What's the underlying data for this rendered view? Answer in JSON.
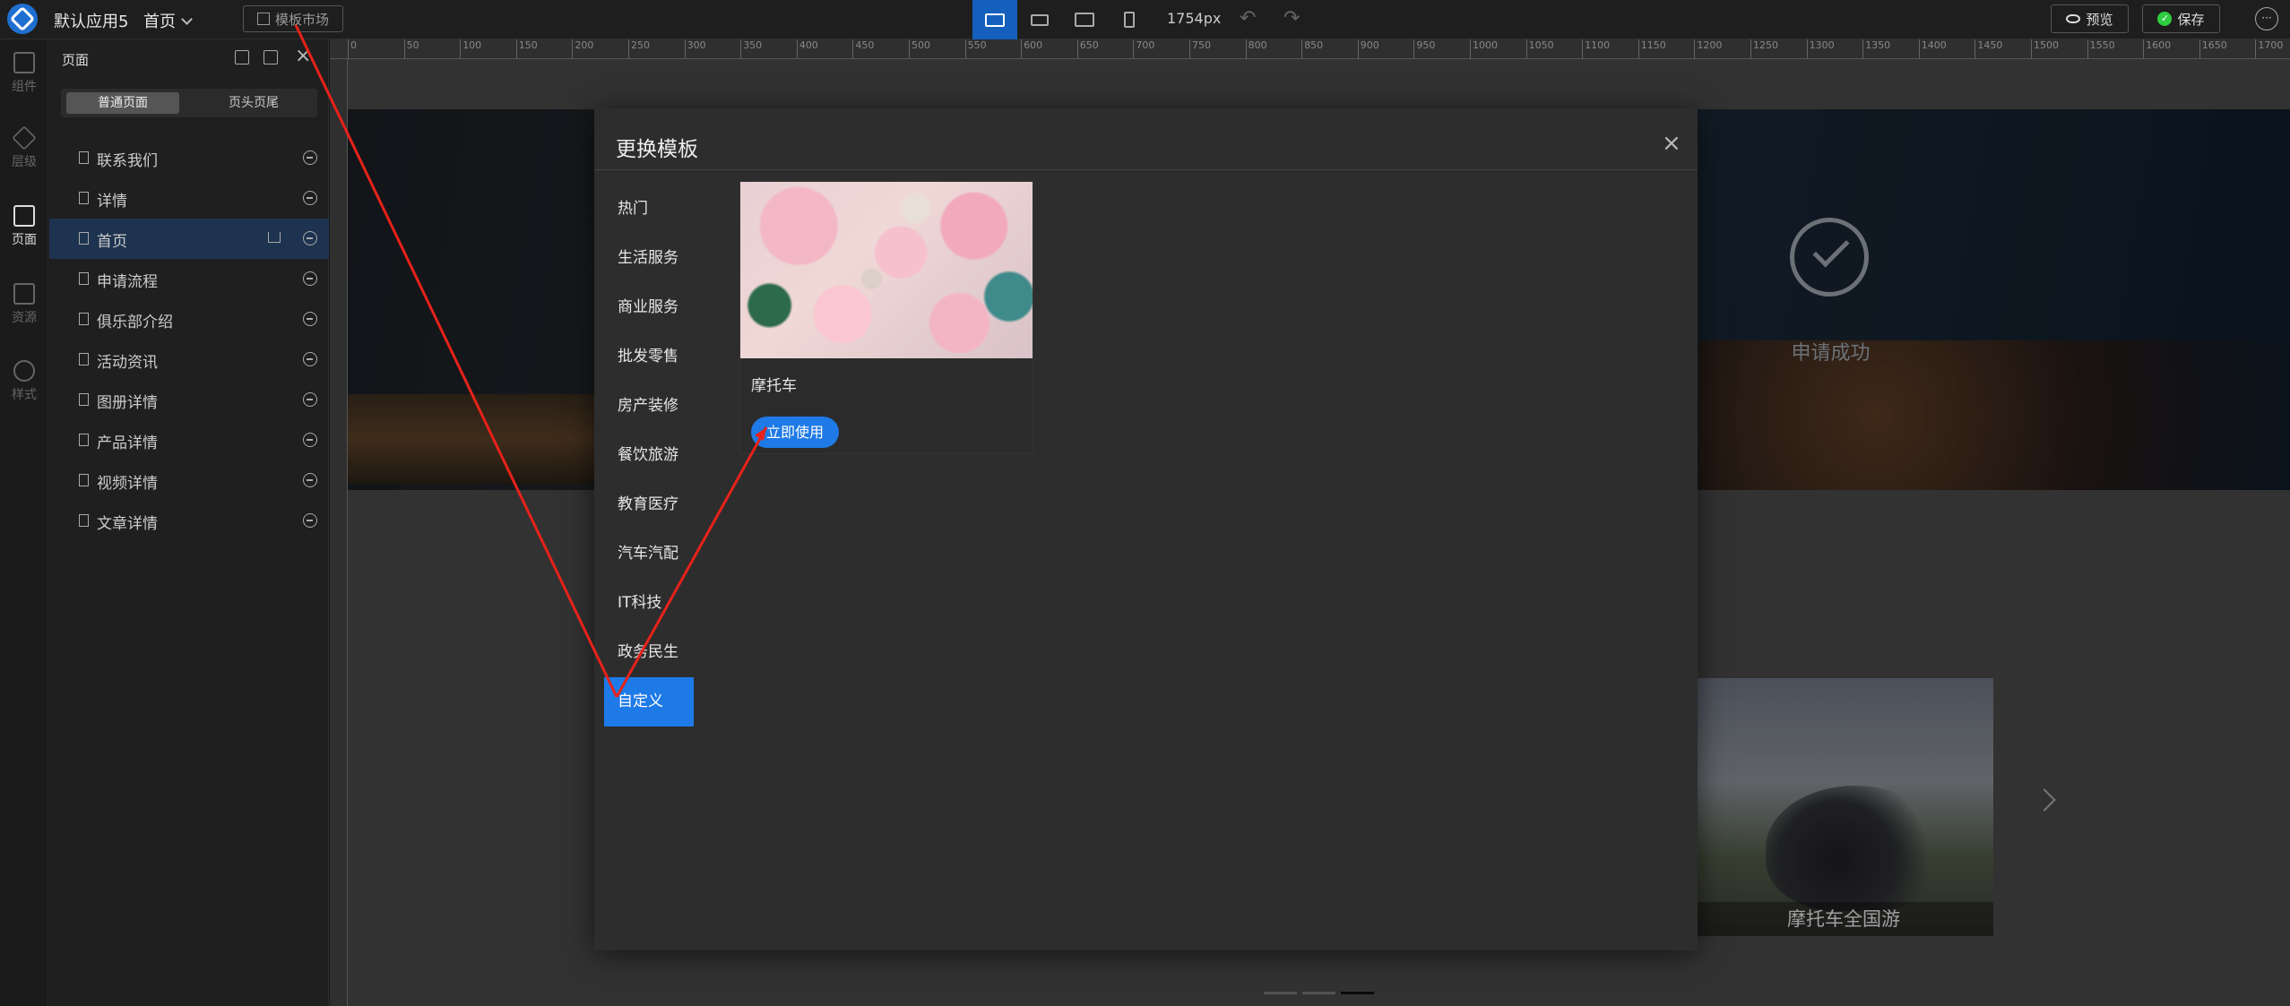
{
  "topbar": {
    "app_name": "默认应用5",
    "page_select": "首页",
    "market_button": "模板市场",
    "px_readout": "1754px",
    "preview_label": "预览",
    "save_label": "保存",
    "more_label": "···"
  },
  "rail": {
    "items": [
      {
        "label": "组件",
        "icon": "grid-icon"
      },
      {
        "label": "层级",
        "icon": "layers-icon"
      },
      {
        "label": "页面",
        "icon": "pages-icon"
      },
      {
        "label": "资源",
        "icon": "image-icon"
      },
      {
        "label": "样式",
        "icon": "brush-icon"
      }
    ]
  },
  "panel": {
    "title": "页面",
    "tabs": [
      "普通页面",
      "页头页尾"
    ],
    "pages": [
      "联系我们",
      "详情",
      "首页",
      "申请流程",
      "俱乐部介绍",
      "活动资讯",
      "图册详情",
      "产品详情",
      "视频详情",
      "文章详情"
    ],
    "active_page": "首页"
  },
  "ruler": {
    "ticks": [
      "0",
      "50",
      "100",
      "150",
      "200",
      "250",
      "300",
      "350",
      "400",
      "450",
      "500",
      "550",
      "600",
      "650",
      "700",
      "750",
      "800",
      "850",
      "900",
      "950",
      "1000",
      "1050",
      "1100",
      "1150",
      "1200",
      "1250",
      "1300",
      "1350",
      "1400",
      "1450",
      "1500",
      "1550",
      "1600",
      "1650",
      "1700"
    ]
  },
  "canvas": {
    "success_text": "申请成功",
    "bike_caption": "摩托车全国游"
  },
  "modal": {
    "title": "更换模板",
    "close": "×",
    "categories": [
      "热门",
      "生活服务",
      "商业服务",
      "批发零售",
      "房产装修",
      "餐饮旅游",
      "教育医疗",
      "汽车汽配",
      "IT科技",
      "政务民生",
      "自定义"
    ],
    "active_category": "自定义",
    "template": {
      "name": "摩托车",
      "use_label": "立即使用"
    }
  },
  "colors": {
    "accent": "#1e7ae6",
    "annotation": "#e8221a"
  }
}
